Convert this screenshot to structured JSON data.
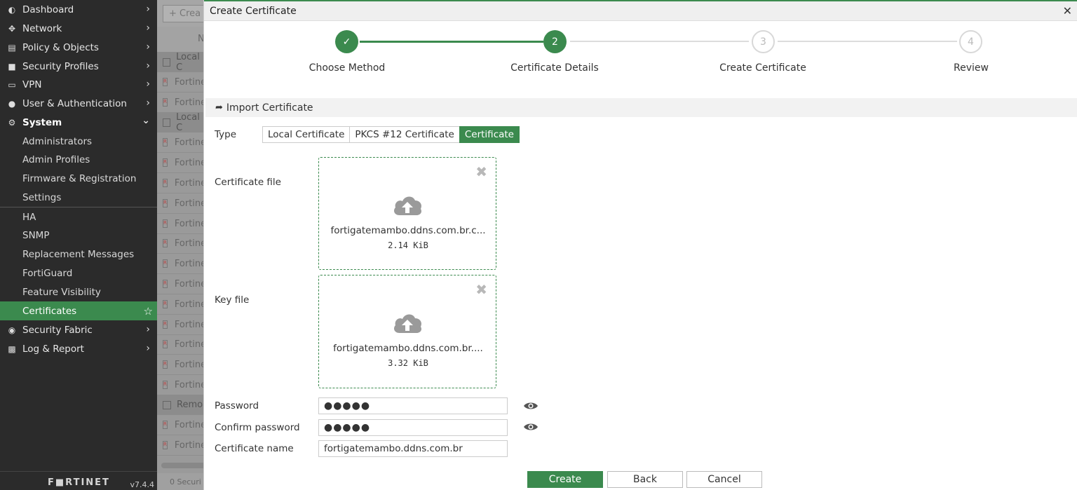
{
  "sidebar": {
    "items": [
      {
        "label": "Dashboard",
        "icon": "dashboard-icon"
      },
      {
        "label": "Network",
        "icon": "network-icon"
      },
      {
        "label": "Policy & Objects",
        "icon": "policy-icon"
      },
      {
        "label": "Security Profiles",
        "icon": "lock-icon"
      },
      {
        "label": "VPN",
        "icon": "monitor-icon"
      },
      {
        "label": "User & Authentication",
        "icon": "user-icon"
      },
      {
        "label": "System",
        "icon": "gear-icon"
      }
    ],
    "system_sub": [
      "Administrators",
      "Admin Profiles",
      "Firmware & Registration",
      "Settings"
    ],
    "system_sub2": [
      "HA",
      "SNMP",
      "Replacement Messages",
      "FortiGuard",
      "Feature Visibility",
      "Certificates"
    ],
    "bottom_items": [
      {
        "label": "Security Fabric",
        "icon": "fabric-icon"
      },
      {
        "label": "Log & Report",
        "icon": "chart-icon"
      }
    ],
    "brand": "F■RTINET",
    "version": "v7.4.4"
  },
  "background": {
    "create_label": "Crea",
    "column_label": "N",
    "group_local": "Local C",
    "group_local2": "Local C",
    "group_remote": "Remo",
    "row_label": "Fortine",
    "status_label": "0  Securi"
  },
  "modal": {
    "title": "Create Certificate",
    "steps": [
      {
        "num": "✓",
        "label": "Choose Method"
      },
      {
        "num": "2",
        "label": "Certificate Details"
      },
      {
        "num": "3",
        "label": "Create Certificate"
      },
      {
        "num": "4",
        "label": "Review"
      }
    ],
    "section_title": "Import Certificate",
    "type_label": "Type",
    "type_options": [
      "Local Certificate",
      "PKCS #12 Certificate",
      "Certificate"
    ],
    "cert_file_label": "Certificate file",
    "cert_file_name": "fortigatemambo.ddns.com.br.c...",
    "cert_file_size": "2.14 KiB",
    "key_file_label": "Key file",
    "key_file_name": "fortigatemambo.ddns.com.br....",
    "key_file_size": "3.32 KiB",
    "password_label": "Password",
    "password_value": "●●●●●",
    "confirm_label": "Confirm password",
    "confirm_value": "●●●●●",
    "certname_label": "Certificate name",
    "certname_value": "fortigatemambo.ddns.com.br",
    "buttons": {
      "create": "Create",
      "back": "Back",
      "cancel": "Cancel"
    }
  },
  "colors": {
    "accent": "#3b8a4e",
    "sidebar": "#2b2b2b"
  }
}
